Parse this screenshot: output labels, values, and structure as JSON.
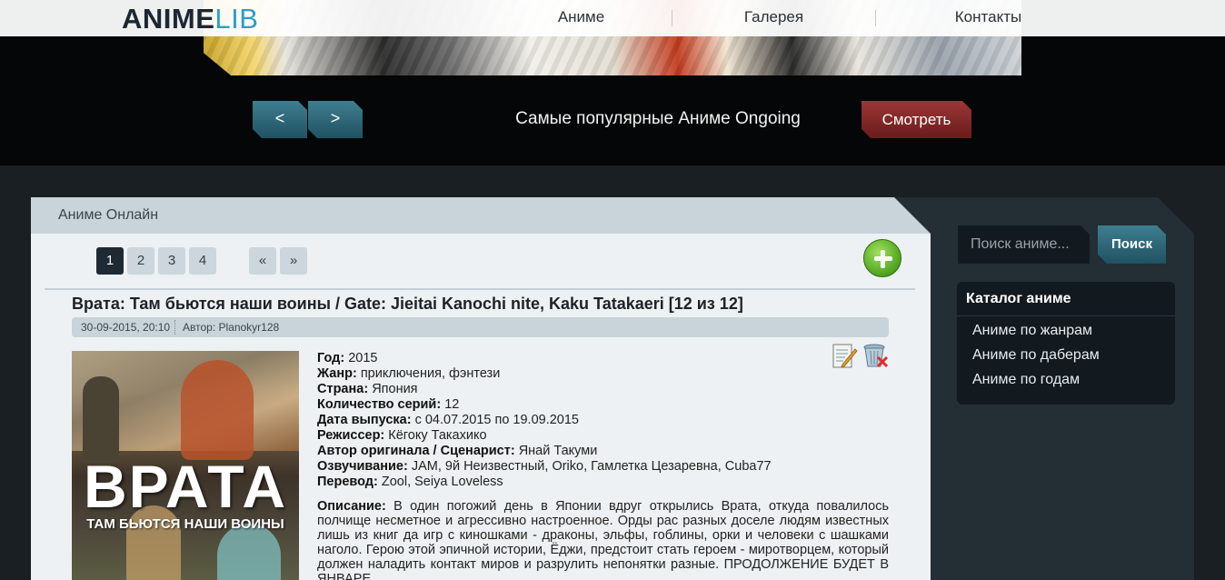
{
  "header": {
    "logo_part1": "ANIME",
    "logo_part2": "LIB",
    "nav": [
      "Аниме",
      "Галерея",
      "Контакты"
    ]
  },
  "slider": {
    "prev_label": "<",
    "next_label": ">",
    "title": "Самые популярные Аниме Ongoing",
    "watch_label": "Смотреть"
  },
  "main": {
    "heading": "Аниме Онлайн",
    "pagination": {
      "pages": [
        "1",
        "2",
        "3",
        "4"
      ],
      "active_page": "1",
      "first_label": "«",
      "last_label": "»"
    },
    "post": {
      "title": "Врата: Там бьются наши воины / Gate: Jieitai Kanochi nite, Kaku Tatakaeri [12 из 12]",
      "date": "30-09-2015, 20:10",
      "author": "Автор: Planokyr128",
      "poster_title": "ВРАТА",
      "poster_subtitle": "ТАМ БЬЮТСЯ НАШИ ВОИНЫ",
      "fields": [
        {
          "label": "Год:",
          "value": "2015"
        },
        {
          "label": "Жанр:",
          "value": "приключения, фэнтези"
        },
        {
          "label": "Страна:",
          "value": "Япония"
        },
        {
          "label": "Количество серий:",
          "value": "12"
        },
        {
          "label": "Дата выпуска:",
          "value": "с 04.07.2015 по 19.09.2015"
        },
        {
          "label": "Режиссер:",
          "value": "Кёгоку Такахико"
        },
        {
          "label": "Автор оригинала / Сценарист:",
          "value": "Янай Такуми"
        },
        {
          "label": "Озвучивание:",
          "value": "JAM, 9й Неизвестный, Oriko, Гамлетка Цезаревна, Cuba77"
        },
        {
          "label": "Перевод:",
          "value": "Zool, Seiya Loveless"
        }
      ],
      "description_label": "Описание:",
      "description": "В один погожий день в Японии вдруг открылись Врата, откуда повалилось полчище несметное и агрессивно настроенное. Орды рас разных доселе людям известных лишь из книг да игр с киношками - драконы, эльфы, гоблины, орки и человеки с шашками наголо. Герою этой эпичной истории, Ёджи, предстоит стать героем - миротворцем, который должен наладить контакт миров и разрулить непонятки разные. ПРОДОЛЖЕНИЕ БУДЕТ В ЯНВАРЕ"
    }
  },
  "sidebar": {
    "search_placeholder": "Поиск аниме...",
    "search_button": "Поиск",
    "catalog_title": "Каталог аниме",
    "catalog_items": [
      "Аниме по жанрам",
      "Аниме по даберам",
      "Аниме по годам"
    ]
  },
  "colors": {
    "accent_teal": "#2b9ec8",
    "button_teal": "#2f6b7b",
    "watch_red": "#8a2a2a",
    "add_green": "#5bb52a"
  }
}
